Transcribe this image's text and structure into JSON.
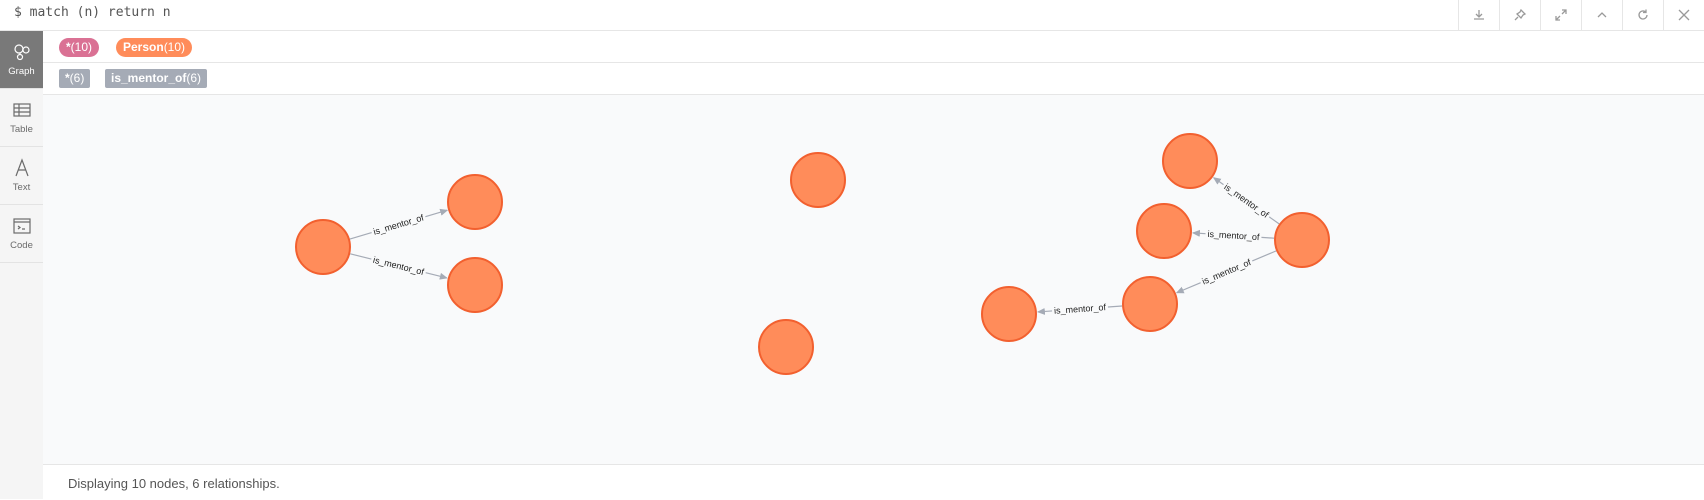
{
  "editor": {
    "query": "$ match (n) return n"
  },
  "toolbar": {
    "actions": [
      "download-icon",
      "pin-icon",
      "expand-icon",
      "collapse-icon",
      "rerun-icon",
      "close-icon"
    ]
  },
  "sidebar": {
    "items": [
      {
        "label": "Graph",
        "icon": "graph-icon",
        "active": true
      },
      {
        "label": "Table",
        "icon": "table-icon"
      },
      {
        "label": "Text",
        "icon": "text-icon"
      },
      {
        "label": "Code",
        "icon": "code-icon"
      }
    ]
  },
  "legend": {
    "nodes": [
      {
        "name": "*",
        "count": "(10)",
        "color": "#da7194"
      },
      {
        "name": "Person",
        "count": "(10)",
        "color": "#ff8c5a"
      }
    ],
    "relationships": [
      {
        "name": "*",
        "count": "(6)",
        "color": "#a5abb6"
      },
      {
        "name": "is_mentor_of",
        "count": "(6)",
        "color": "#a5abb6"
      }
    ]
  },
  "graph": {
    "node_color": "#ff8c5a",
    "node_border": "#f2602f",
    "relationship_type": "is_mentor_of"
  },
  "status": {
    "text": "Displaying 10 nodes, 6 relationships."
  }
}
